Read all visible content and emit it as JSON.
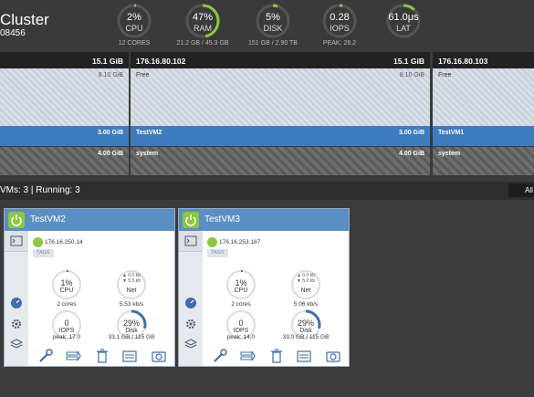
{
  "cluster": {
    "title": "Cluster",
    "id": "08456"
  },
  "gauges": [
    {
      "value": "2%",
      "label": "CPU",
      "sub": "12 CORES",
      "fill": 0.02
    },
    {
      "value": "47%",
      "label": "RAM",
      "sub": "21.2 GB / 45.3 GB",
      "fill": 0.47
    },
    {
      "value": "5%",
      "label": "DISK",
      "sub": "151 GB / 2.90 TB",
      "fill": 0.05
    },
    {
      "value": "0.28",
      "label": "IOPS",
      "sub": "PEAK: 26.2",
      "fill": 0.03
    },
    {
      "value": "61.0μs",
      "label": "LAT",
      "sub": "",
      "fill": 0.12
    }
  ],
  "hosts": [
    {
      "name": "",
      "total": "15.1 GiB",
      "free_label": "",
      "free_value": "8.10 GiB",
      "vm_label": "",
      "vm_value": "3.00 GiB",
      "sys_label": "",
      "sys_value": "4.00 GiB"
    },
    {
      "name": "176.16.80.102",
      "total": "15.1 GiB",
      "free_label": "Free",
      "free_value": "8.10 GiB",
      "vm_label": "TestVM2",
      "vm_value": "3.00 GiB",
      "sys_label": "system",
      "sys_value": "4.00 GiB"
    },
    {
      "name": "176.16.80.103",
      "total": "",
      "free_label": "Free",
      "free_value": "",
      "vm_label": "TestVM1",
      "vm_value": "",
      "sys_label": "system",
      "sys_value": ""
    }
  ],
  "vm_bar": {
    "count": "VMs: 3 | Running: 3",
    "all_button": "All"
  },
  "vms": [
    {
      "name": "TestVM2",
      "ip": "176.16.250.14",
      "tags": "TAGS",
      "cpu": "1%",
      "cpu_label": "CPU",
      "cpu_sub": "2 cores",
      "net_up": "▲ 0.0 kb",
      "net_down": "▼ 5.5 kb",
      "net_label": "Net",
      "net_sub": "5.53 kb/s",
      "iops": "0",
      "iops_label": "IOPS",
      "iops_sub": "peak: 17.0",
      "disk": "29%",
      "disk_label": "Disk",
      "disk_sub": "33.1 GB / 115 GB",
      "disk_fill": 0.29,
      "cpu_fill": 0.01
    },
    {
      "name": "TestVM3",
      "ip": "176.16.253.187",
      "tags": "TAGS",
      "cpu": "1%",
      "cpu_label": "CPU",
      "cpu_sub": "2 cores",
      "net_up": "▲ 0.0 kb",
      "net_down": "▼ 5.0 kb",
      "net_label": "Net",
      "net_sub": "5.06 kb/s",
      "iops": "0",
      "iops_label": "IOPS",
      "iops_sub": "peak: 14.0",
      "disk": "29%",
      "disk_label": "Disk",
      "disk_sub": "33.0 GB / 115 GB",
      "disk_fill": 0.29,
      "cpu_fill": 0.01
    }
  ],
  "colors": {
    "accent": "#5b8fc4",
    "power": "#8dc63f",
    "gauge_fill": "#8dc63f"
  }
}
